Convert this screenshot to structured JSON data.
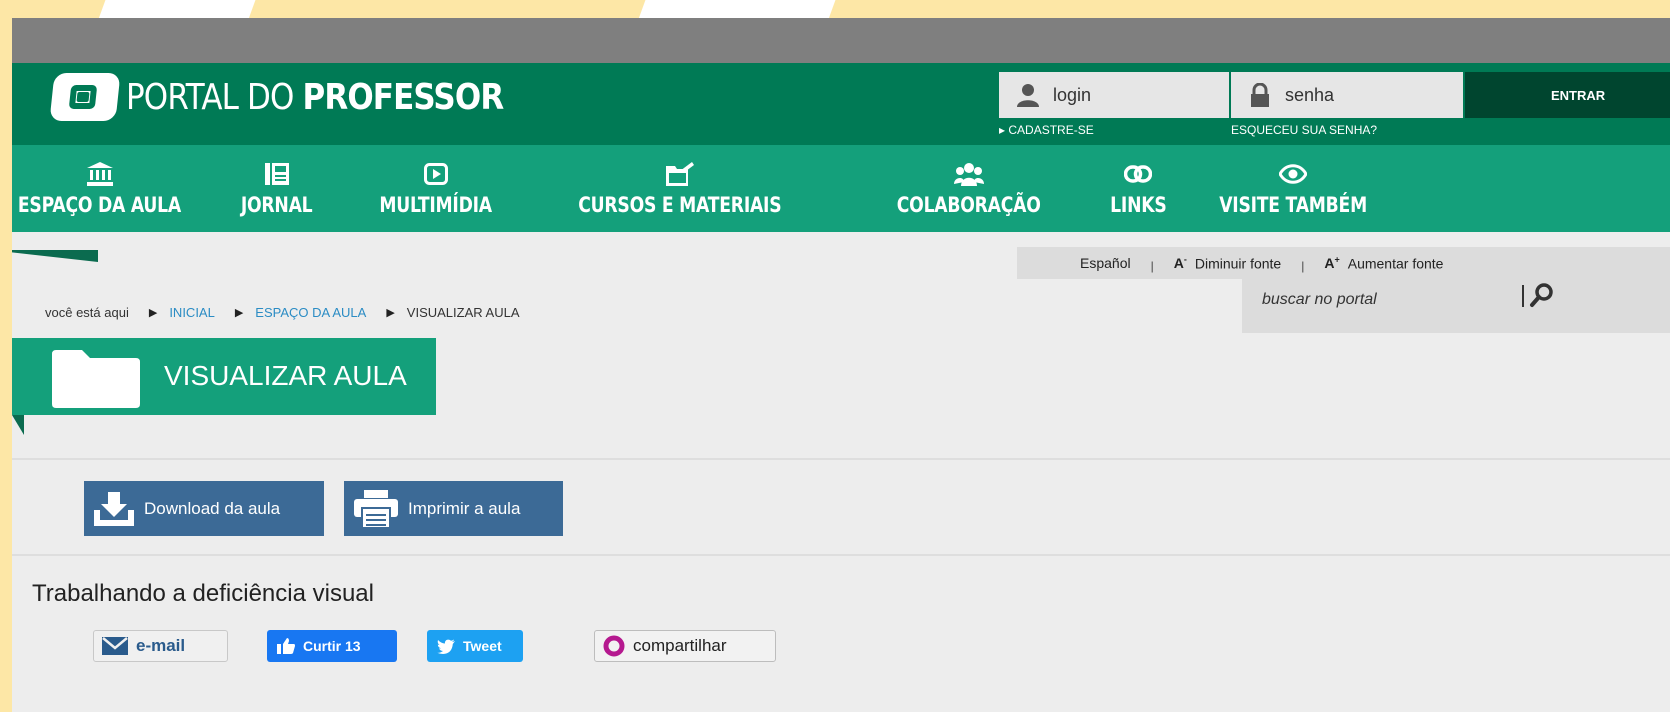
{
  "header": {
    "logo_prefix": "PORTAL DO",
    "logo_strong": "PROFESSOR"
  },
  "auth": {
    "login_placeholder": "login",
    "password_placeholder": "senha",
    "enter_label": "ENTRAR",
    "register_link": "▸ CADASTRE-SE",
    "forgot_link": "ESQUECEU SUA SENHA?"
  },
  "nav": {
    "items": [
      {
        "label": "ESPAÇO DA AULA",
        "icon": "building-icon"
      },
      {
        "label": "JORNAL",
        "icon": "newspaper-icon"
      },
      {
        "label": "MULTIMÍDIA",
        "icon": "play-icon"
      },
      {
        "label": "CURSOS E MATERIAIS",
        "icon": "folder-open-icon"
      },
      {
        "label": "COLABORAÇÃO",
        "icon": "users-icon"
      },
      {
        "label": "LINKS",
        "icon": "link-icon"
      },
      {
        "label": "VISITE TAMBÉM",
        "icon": "eye-icon"
      }
    ]
  },
  "tools": {
    "language": "Español",
    "decrease_symbol": "A",
    "decrease_sup": "-",
    "decrease_label": "Diminuir fonte",
    "increase_symbol": "A",
    "increase_sup": "+",
    "increase_label": "Aumentar fonte",
    "separator": "|"
  },
  "search": {
    "placeholder": "buscar no portal"
  },
  "breadcrumb": {
    "prefix": "você está aqui",
    "separator": "▶",
    "items": [
      "INICIAL",
      "ESPAÇO DA AULA",
      "VISUALIZAR AULA"
    ]
  },
  "page": {
    "title": "VISUALIZAR AULA",
    "lesson_title": "Trabalhando a deficiência visual"
  },
  "actions": {
    "download_label": "Download da aula",
    "print_label": "Imprimir a aula"
  },
  "share": {
    "email_label": "e-mail",
    "like_label": "Curtir 13",
    "tweet_label": "Tweet",
    "share_label": "compartilhar"
  },
  "colors": {
    "header_dark": "#007a55",
    "nav_green": "#14a07b",
    "button_blue": "#3c6a96",
    "background_yellow": "#fde7a6"
  }
}
